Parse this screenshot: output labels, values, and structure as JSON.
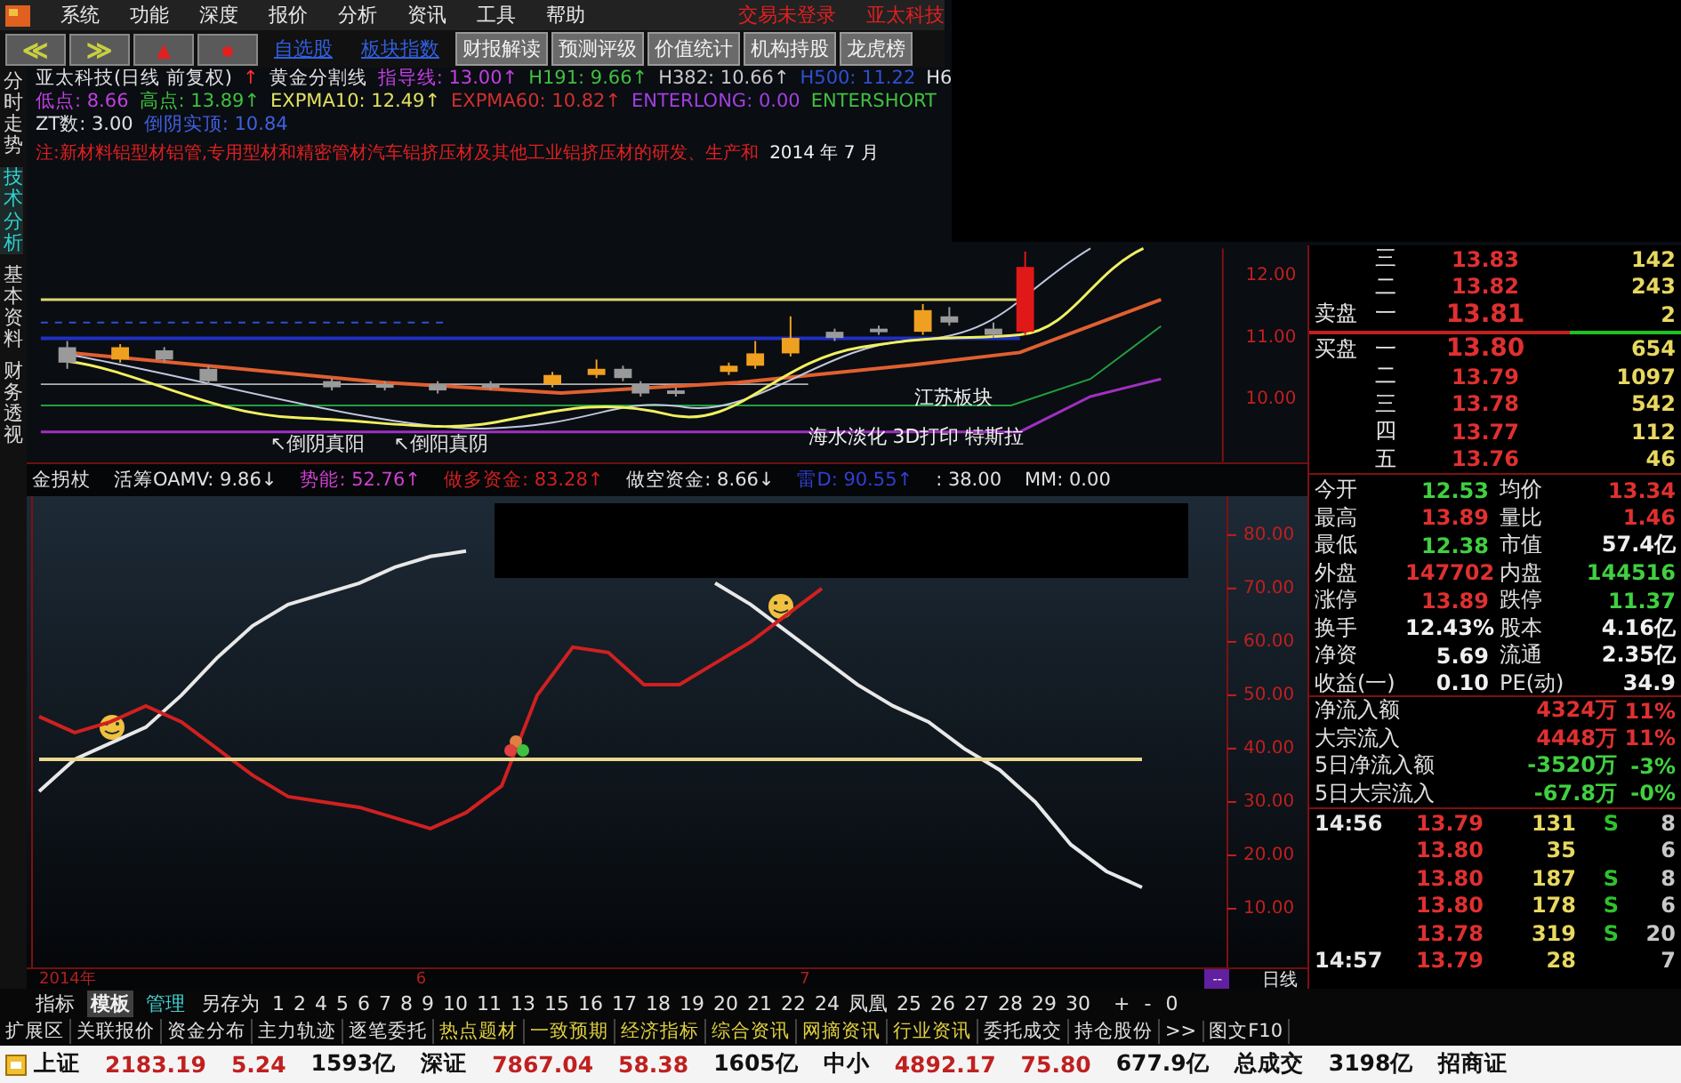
{
  "menu_bar": {
    "items": [
      "系统",
      "功能",
      "深度",
      "报价",
      "分析",
      "资讯",
      "工具",
      "帮助"
    ],
    "status_texts": [
      "交易未登录",
      "亚太科技"
    ]
  },
  "toolbar": {
    "nav_buttons": [
      {
        "glyph": "≪",
        "color": "#c8d040"
      },
      {
        "glyph": "≫",
        "color": "#c8d040"
      },
      {
        "glyph": "▲",
        "color": "#e02020"
      },
      {
        "glyph": "●",
        "color": "#e02020"
      }
    ],
    "links": [
      "自选股",
      "板块指数"
    ],
    "buttons": [
      "财报解读",
      "预测评级",
      "价值统计",
      "机构持股",
      "龙虎榜"
    ]
  },
  "side_tabs": [
    {
      "label": "分时走势",
      "selected": false
    },
    {
      "label": "技术分析",
      "selected": true
    },
    {
      "label": "基本资料",
      "selected": false
    },
    {
      "label": "财务透视",
      "selected": false
    }
  ],
  "chart_header": {
    "lines": [
      [
        {
          "text": "亚太科技(日线 前复权)",
          "color": "#e0e0e0"
        },
        {
          "text": "↑",
          "color": "#ff3030"
        },
        {
          "text": "黄金分割线",
          "color": "#e0e0e0"
        },
        {
          "text": "指导线: 13.00↑",
          "color": "#c040e0"
        },
        {
          "text": "H191: 9.66↑",
          "color": "#40c040"
        },
        {
          "text": "H382: 10.66↑",
          "color": "#c8c8c8"
        },
        {
          "text": "H500: 11.22",
          "color": "#3050d0"
        },
        {
          "text": "H6",
          "color": "#e0e0e0"
        }
      ],
      [
        {
          "text": "低点: 8.66",
          "color": "#c040e0"
        },
        {
          "text": "高点: 13.89↑",
          "color": "#40c040"
        },
        {
          "text": "EXPMA10: 12.49↑",
          "color": "#e0e060"
        },
        {
          "text": "EXPMA60: 10.82↑",
          "color": "#d03030"
        },
        {
          "text": "ENTERLONG: 0.00",
          "color": "#a040e0"
        },
        {
          "text": "ENTERSHORT",
          "color": "#40c040"
        }
      ],
      [
        {
          "text": "ZT数: 3.00",
          "color": "#e0e0e0"
        },
        {
          "text": "倒阴实顶: 10.84",
          "color": "#4060e0"
        }
      ]
    ],
    "notice": "注:新材料铝型材铝管,专用型材和精密管材汽车铝挤压材及其他工业铝挤压材的研发、生产和",
    "notice_date": "2014 年 7 月"
  },
  "price_axis": [
    "12.00",
    "11.00",
    "10.00"
  ],
  "annotations": [
    {
      "text": "↖倒阴真阳",
      "color": "#e0e0e0"
    },
    {
      "text": "↖倒阳真阴",
      "color": "#e0e0e0"
    },
    {
      "text": "江苏板块",
      "color": "#f0f0f0"
    },
    {
      "text": "海水淡化 3D打印 特斯拉",
      "color": "#f0f0f0"
    }
  ],
  "indicator_header": [
    {
      "text": "金拐杖",
      "color": "#e0e0e0"
    },
    {
      "text": "活筹OAMV: 9.86↓",
      "color": "#e0e0e0"
    },
    {
      "text": "势能: 52.76↑",
      "color": "#d040d0"
    },
    {
      "text": "做多资金: 83.28↑",
      "color": "#d02020"
    },
    {
      "text": "做空资金: 8.66↓",
      "color": "#e0e0e0"
    },
    {
      "text": "雷D: 90.55↑",
      "color": "#3040d0"
    },
    {
      "text": ": 38.00",
      "color": "#e0e0e0"
    },
    {
      "text": "MM: 0.00",
      "color": "#e0e0e0"
    }
  ],
  "indicator_chart": {
    "chart_data": {
      "type": "line",
      "categories": [
        null,
        null,
        null,
        null,
        null,
        null,
        null,
        null,
        null,
        null,
        null,
        null,
        null,
        null,
        null,
        null,
        null,
        null,
        null,
        null,
        null,
        null,
        null,
        null,
        null,
        null,
        null,
        null,
        null,
        null,
        null,
        null
      ],
      "yticks": [
        {
          "value": 80,
          "label": "80.00"
        },
        {
          "value": 70,
          "label": "70.00"
        },
        {
          "value": 60,
          "label": "60.00"
        },
        {
          "value": 50,
          "label": "50.00"
        },
        {
          "value": 40,
          "label": "40.00"
        },
        {
          "value": 30,
          "label": "30.00"
        },
        {
          "value": 20,
          "label": "20.00"
        },
        {
          "value": 10,
          "label": "10.00"
        }
      ],
      "ylim": [
        -1,
        87.3
      ],
      "series": [
        {
          "color": "#e8e8e8",
          "values": [
            32,
            38,
            41,
            44,
            50,
            57,
            63,
            67,
            69,
            71,
            74,
            76,
            77,
            null,
            null,
            null,
            null,
            null,
            null,
            71,
            67,
            62,
            57,
            52,
            48,
            45,
            40,
            36,
            30,
            22,
            17,
            14
          ]
        },
        {
          "color": "#d02020",
          "values": [
            46,
            43,
            45,
            48,
            45,
            40,
            35,
            31,
            30,
            29,
            27,
            25,
            28,
            33,
            50,
            59,
            58,
            52,
            52,
            56,
            60,
            65,
            70,
            null,
            null,
            null,
            null,
            null,
            null,
            null,
            null,
            null
          ]
        },
        {
          "color": "#e8d890",
          "values": [
            38,
            38,
            38,
            38,
            38,
            38,
            38,
            38,
            38,
            38,
            38,
            38,
            38,
            38,
            38,
            38,
            38,
            38,
            38,
            38,
            38,
            38,
            38,
            38,
            38,
            38,
            38,
            38,
            38,
            38,
            38,
            38
          ]
        }
      ]
    }
  },
  "date_axis": {
    "labels": [
      "2014年",
      "6",
      "7"
    ],
    "button": "--",
    "period": "日线"
  },
  "template_tabs": {
    "items": [
      {
        "label": "指标",
        "selected": false,
        "color": "#e0e0e0"
      },
      {
        "label": "模板",
        "selected": true,
        "color": "#f0f0f0"
      },
      {
        "label": "管理",
        "selected": false,
        "color": "#40d0d0"
      },
      {
        "label": "另存为",
        "selected": false,
        "color": "#e0e0e0"
      }
    ],
    "numbers": [
      "1",
      "2",
      "4",
      "5",
      "6",
      "7",
      "8",
      "9",
      "10",
      "11",
      "13",
      "15",
      "16",
      "17",
      "18",
      "19",
      "20",
      "21",
      "22",
      "24",
      "凤凰",
      "25",
      "26",
      "27",
      "28",
      "29",
      "30"
    ],
    "controls": [
      "+",
      "-",
      "0"
    ]
  },
  "function_tabs": [
    {
      "label": "扩展区",
      "color": "#e0e0e0"
    },
    {
      "label": "关联报价",
      "color": "#e0e0e0"
    },
    {
      "label": "资金分布",
      "color": "#e0e0e0"
    },
    {
      "label": "主力轨迹",
      "color": "#e0e0e0"
    },
    {
      "label": "逐笔委托",
      "color": "#e0e0e0"
    },
    {
      "label": "热点题材",
      "color": "#e0d040"
    },
    {
      "label": "一致预期",
      "color": "#e0d040"
    },
    {
      "label": "经济指标",
      "color": "#e0d040"
    },
    {
      "label": "综合资讯",
      "color": "#e0d040"
    },
    {
      "label": "网摘资讯",
      "color": "#e0d040"
    },
    {
      "label": "行业资讯",
      "color": "#e0d040"
    },
    {
      "label": "委托成交",
      "color": "#e0e0e0"
    },
    {
      "label": "持仓股份",
      "color": "#e0e0e0"
    },
    {
      "label": ">>",
      "color": "#e0e0e0"
    },
    {
      "label": "图文F10",
      "color": "#e0e0e0"
    }
  ],
  "order_book": {
    "asks": [
      {
        "rank": "三",
        "price": "13.83",
        "volume": "142"
      },
      {
        "rank": "二",
        "price": "13.82",
        "volume": "243"
      },
      {
        "label": "卖盘",
        "rank": "一",
        "price": "13.81",
        "volume": "2"
      }
    ],
    "bids": [
      {
        "label": "买盘",
        "rank": "一",
        "price": "13.80",
        "volume": "654"
      },
      {
        "rank": "二",
        "price": "13.79",
        "volume": "1097"
      },
      {
        "rank": "三",
        "price": "13.78",
        "volume": "542"
      },
      {
        "rank": "四",
        "price": "13.77",
        "volume": "112"
      },
      {
        "rank": "五",
        "price": "13.76",
        "volume": "46"
      }
    ]
  },
  "quote_stats": [
    [
      {
        "label": "今开",
        "value": "12.53",
        "color": "#40d040"
      },
      {
        "label": "均价",
        "value": "13.34",
        "color": "#e03030"
      }
    ],
    [
      {
        "label": "最高",
        "value": "13.89",
        "color": "#e03030"
      },
      {
        "label": "量比",
        "value": "1.46",
        "color": "#e03030"
      }
    ],
    [
      {
        "label": "最低",
        "value": "12.38",
        "color": "#40d040"
      },
      {
        "label": "市值",
        "value": "57.4亿",
        "color": "#f0f0f0"
      }
    ],
    [
      {
        "label": "外盘",
        "value": "147702",
        "color": "#e03030"
      },
      {
        "label": "内盘",
        "value": "144516",
        "color": "#40d040"
      }
    ],
    [
      {
        "label": "涨停",
        "value": "13.89",
        "color": "#e03030"
      },
      {
        "label": "跌停",
        "value": "11.37",
        "color": "#40d040"
      }
    ],
    [
      {
        "label": "换手",
        "value": "12.43%",
        "color": "#f0f0f0"
      },
      {
        "label": "股本",
        "value": "4.16亿",
        "color": "#f0f0f0"
      }
    ],
    [
      {
        "label": "净资",
        "value": "5.69",
        "color": "#f0f0f0"
      },
      {
        "label": "流通",
        "value": "2.35亿",
        "color": "#f0f0f0"
      }
    ],
    [
      {
        "label": "收益(一)",
        "value": "0.10",
        "color": "#f0f0f0"
      },
      {
        "label": "PE(动)",
        "value": "34.9",
        "color": "#f0f0f0"
      }
    ]
  ],
  "fund_flows": [
    {
      "label": "净流入额",
      "amount": "4324万",
      "percent": "11%",
      "color": "#e03030"
    },
    {
      "label": "大宗流入",
      "amount": "4448万",
      "percent": "11%",
      "color": "#e03030"
    },
    {
      "label": "5日净流入额",
      "amount": "-3520万",
      "percent": "-3%",
      "color": "#40d040"
    },
    {
      "label": "5日大宗流入",
      "amount": "-67.8万",
      "percent": "-0%",
      "color": "#40d040"
    }
  ],
  "ticks": [
    {
      "time": "14:56",
      "price": "13.79",
      "volume": "131",
      "side": "S",
      "count": "8"
    },
    {
      "price": "13.80",
      "volume": "35",
      "count": "6"
    },
    {
      "price": "13.80",
      "volume": "187",
      "side": "S",
      "count": "8"
    },
    {
      "price": "13.80",
      "volume": "178",
      "side": "S",
      "count": "6"
    },
    {
      "price": "13.78",
      "volume": "319",
      "side": "S",
      "count": "20"
    },
    {
      "time": "14:57",
      "price": "13.79",
      "volume": "28",
      "count": "7"
    }
  ],
  "status_bar": [
    {
      "text": "上证",
      "color": "#111111"
    },
    {
      "text": "2183.19",
      "color": "#c02020"
    },
    {
      "text": "5.24",
      "color": "#c02020"
    },
    {
      "text": "1593亿",
      "color": "#111111"
    },
    {
      "text": "深证",
      "color": "#111111"
    },
    {
      "text": "7867.04",
      "color": "#c02020"
    },
    {
      "text": "58.38",
      "color": "#c02020"
    },
    {
      "text": "1605亿",
      "color": "#111111"
    },
    {
      "text": "中小",
      "color": "#111111"
    },
    {
      "text": "4892.17",
      "color": "#c02020"
    },
    {
      "text": "75.80",
      "color": "#c02020"
    },
    {
      "text": "677.9亿",
      "color": "#111111"
    },
    {
      "text": "总成交",
      "color": "#111111"
    },
    {
      "text": "3198亿",
      "color": "#111111"
    },
    {
      "text": "招商证",
      "color": "#111111"
    }
  ]
}
